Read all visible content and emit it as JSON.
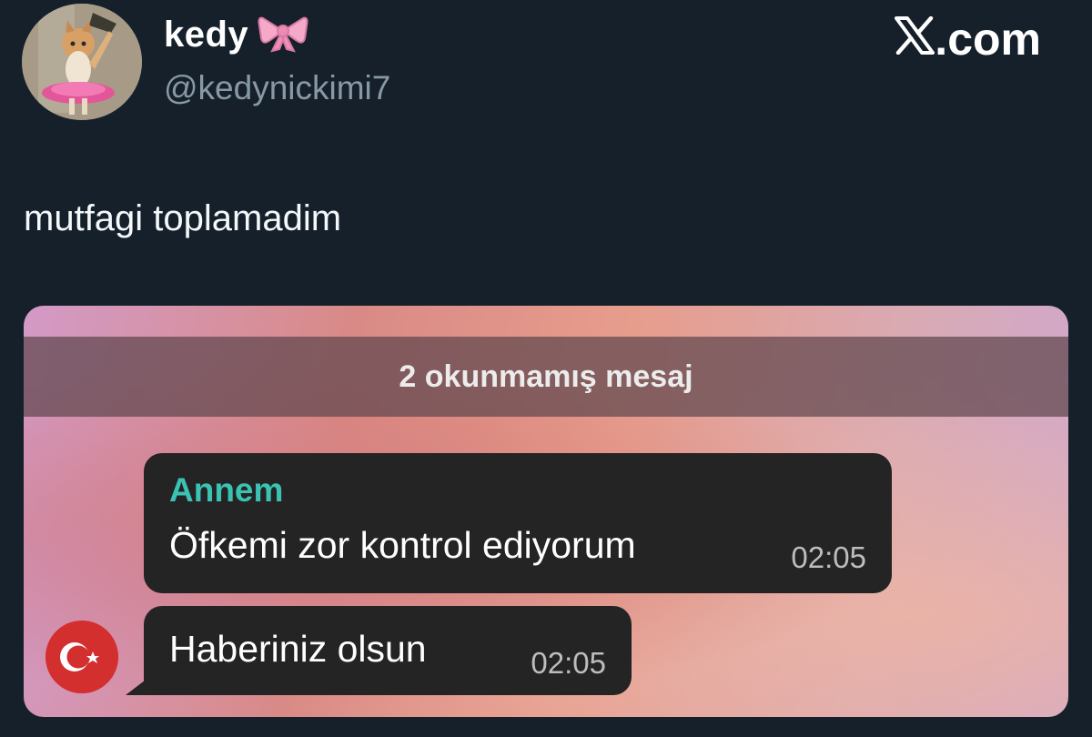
{
  "author": {
    "display_name": "kedy",
    "name_emoji": "ribbon-icon",
    "handle": "@kedynickimi7"
  },
  "brand": {
    "label": ".com",
    "logo": "x-logo-icon"
  },
  "tweet": {
    "text": "mutfagi toplamadim"
  },
  "chat": {
    "unread_banner": "2 okunmamış mesaj",
    "messages": [
      {
        "sender": "Annem",
        "text": "Öfkemi zor kontrol ediyorum",
        "time": "02:05"
      },
      {
        "text": "Haberiniz olsun",
        "time": "02:05"
      }
    ]
  },
  "colors": {
    "background": "#15202b",
    "handle": "#8899a6",
    "sender_name": "#3ac2b3",
    "bubble": "#242424"
  }
}
